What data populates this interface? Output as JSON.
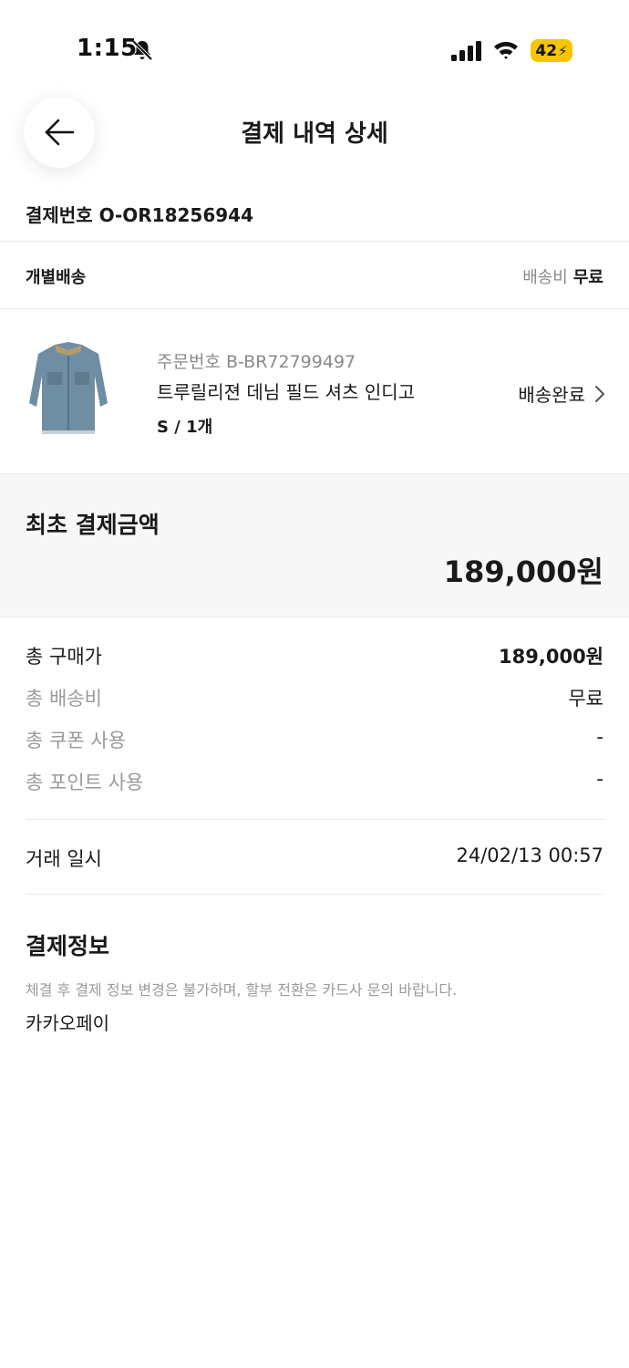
{
  "status_bar": {
    "time": "1:15",
    "battery": "42"
  },
  "header": {
    "title": "결제 내역 상세"
  },
  "payment": {
    "number_label": "결제번호",
    "number": "O-OR18256944"
  },
  "shipping": {
    "type": "개별배송",
    "fee_label": "배송비",
    "fee_value": "무료"
  },
  "product": {
    "order_number_label": "주문번호",
    "order_number": "B-BR72799497",
    "name": "트루릴리젼 데님 필드 셔츠 인디고",
    "option": "S / 1개",
    "delivery_status": "배송완료"
  },
  "initial_payment": {
    "label": "최초 결제금액",
    "amount": "189,000원"
  },
  "summary": {
    "total_price_label": "총 구매가",
    "total_price": "189,000원",
    "total_shipping_label": "총 배송비",
    "total_shipping": "무료",
    "coupon_label": "총 쿠폰 사용",
    "coupon": "-",
    "points_label": "총 포인트 사용",
    "points": "-"
  },
  "transaction": {
    "label": "거래 일시",
    "datetime": "24/02/13 00:57"
  },
  "payment_info": {
    "title": "결제정보",
    "notice": "체결 후 결제 정보 변경은 불가하며, 할부 전환은 카드사 문의 바랍니다.",
    "method": "카카오페이"
  },
  "icons": {
    "back": "arrow-left-icon",
    "chevron": "chevron-right-icon",
    "bell": "bell-slash-icon",
    "signal": "cellular-signal-icon",
    "wifi": "wifi-icon"
  },
  "colors": {
    "battery": "#f7c600",
    "muted_text": "#9a9a9a",
    "section_bg": "#f7f7f7"
  }
}
